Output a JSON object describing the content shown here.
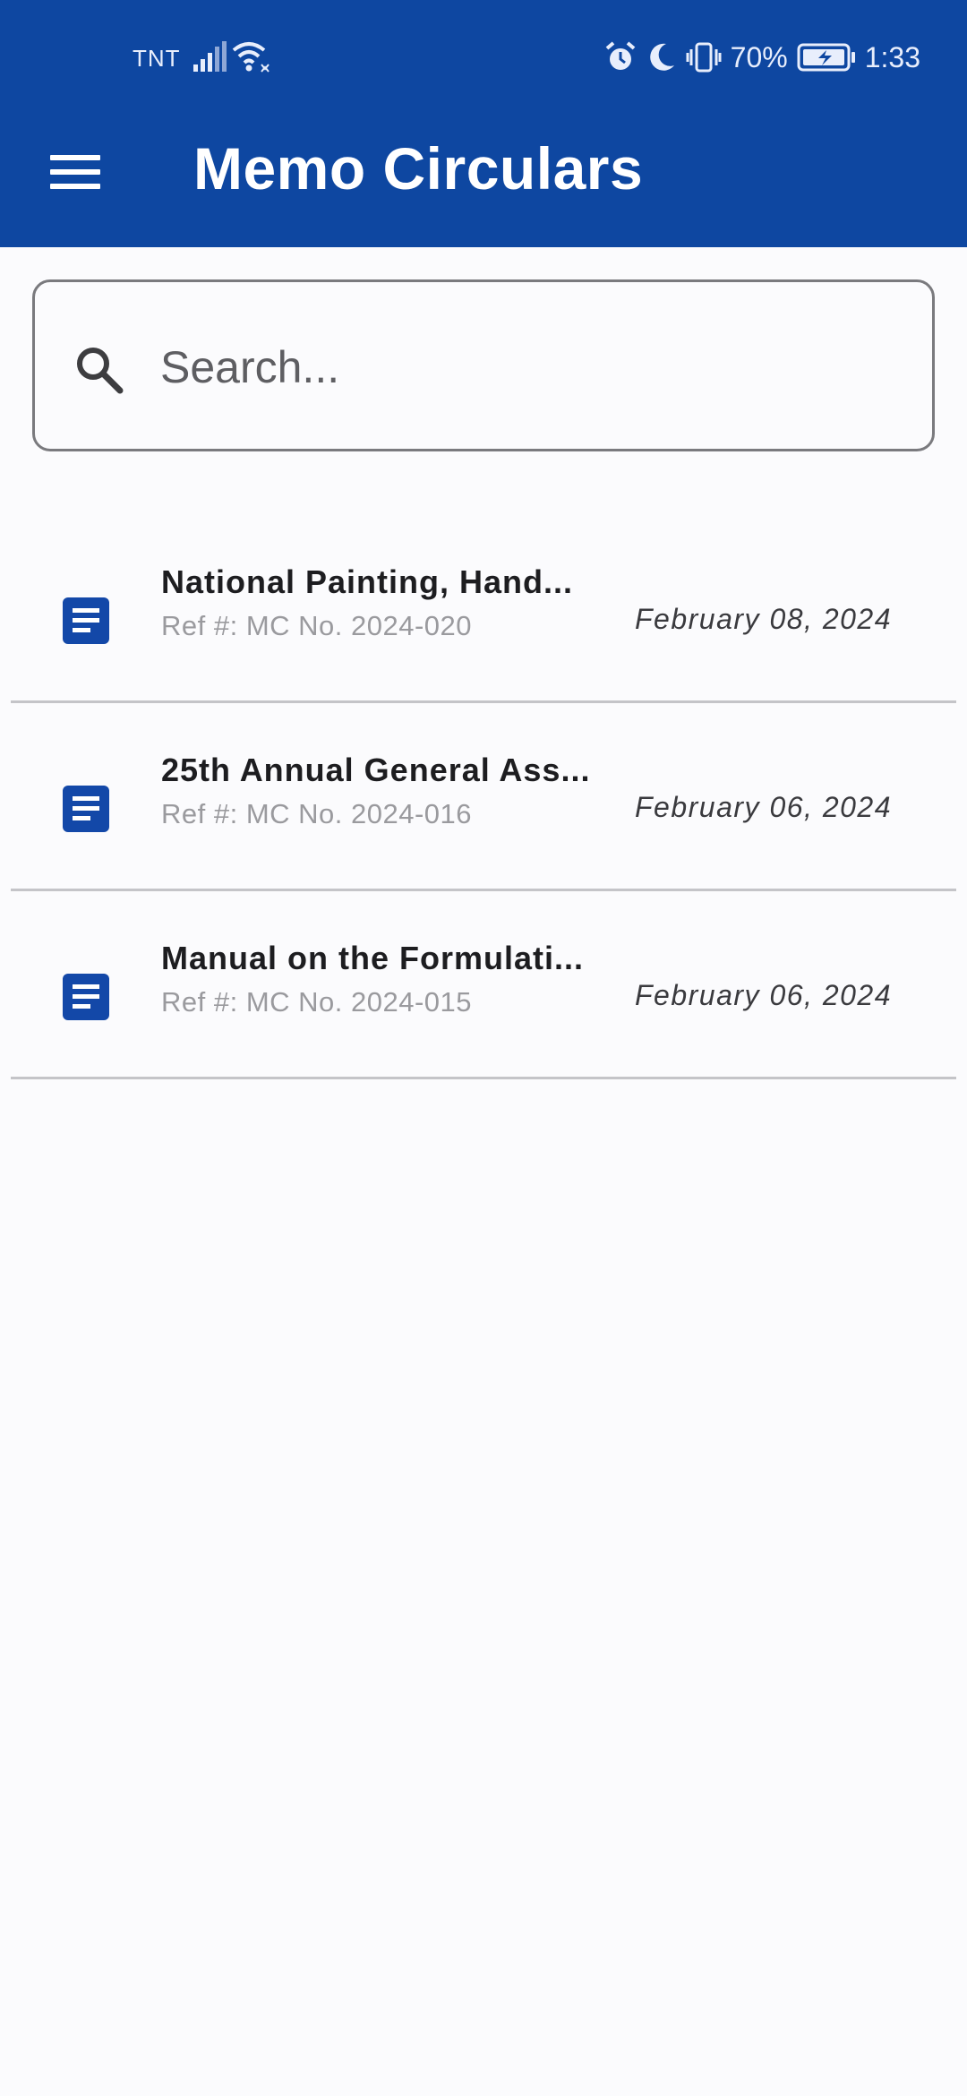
{
  "status_bar": {
    "carrier": "TNT",
    "battery_percent": "70%",
    "time": "1:33",
    "icons": [
      "signal-icon",
      "wifi-icon",
      "alarm-icon",
      "moon-icon",
      "vibrate-icon",
      "battery-charging-icon"
    ]
  },
  "header": {
    "title": "Memo Circulars",
    "menu_icon": "hamburger-menu-icon",
    "background": "#0e47a1"
  },
  "search": {
    "placeholder": "Search...",
    "value": "",
    "icon": "search-icon"
  },
  "memos": [
    {
      "title": "National Painting, Hand...",
      "ref": "Ref #: MC No. 2024-020",
      "date": "February 08, 2024",
      "icon": "document-icon"
    },
    {
      "title": "25th Annual General Ass...",
      "ref": "Ref #: MC No. 2024-016",
      "date": "February 06, 2024",
      "icon": "document-icon"
    },
    {
      "title": "Manual on the Formulati...",
      "ref": "Ref #: MC No. 2024-015",
      "date": "February 06, 2024",
      "icon": "document-icon"
    }
  ],
  "colors": {
    "accent": "#0e47a1",
    "icon_blue": "#1348a8",
    "divider": "#c4c4c8"
  }
}
